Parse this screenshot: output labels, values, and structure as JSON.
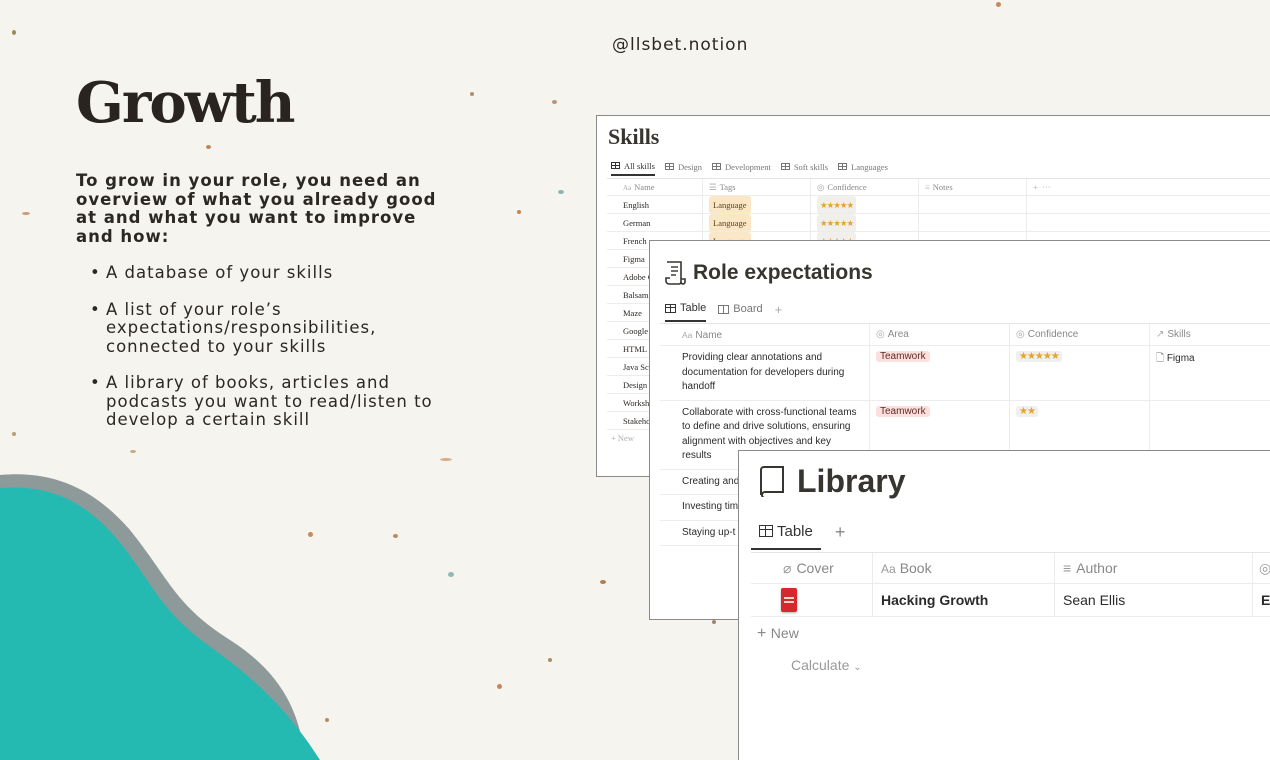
{
  "handle": "@llsbet.notion",
  "title": "Growth",
  "intro": "To grow in your role, you need an overview of what you already good at and what you want to improve and how:",
  "bullets": [
    "A database of your skills",
    "A list of your role’s expectations/responsibilities, connected to your skills",
    "A library of books, articles and podcasts you want to read/listen to develop a certain skill"
  ],
  "colors": {
    "background": "#f6f4ee",
    "teal": "#24bab2",
    "teal_shadow": "#8e9a9a"
  },
  "skills": {
    "title": "Skills",
    "tabs": [
      "All skills",
      "Design",
      "Development",
      "Soft skills",
      "Languages"
    ],
    "columns": {
      "name": "Name",
      "tags": "Tags",
      "confidence": "Confidence",
      "notes": "Notes"
    },
    "rows": [
      {
        "name": "English",
        "tag": "Language",
        "stars": "★★★★★"
      },
      {
        "name": "German",
        "tag": "Language",
        "stars": "★★★★★"
      },
      {
        "name": "French",
        "tag": "Language",
        "stars": "★★★★★"
      },
      {
        "name": "Figma"
      },
      {
        "name": "Adobe C"
      },
      {
        "name": "Balsami"
      },
      {
        "name": "Maze"
      },
      {
        "name": "Google"
      },
      {
        "name": "HTML"
      },
      {
        "name": "Java Scr"
      },
      {
        "name": "Design"
      },
      {
        "name": "Worksh"
      },
      {
        "name": "Stakeho"
      }
    ],
    "new_label": "New"
  },
  "role": {
    "title": "Role expectations",
    "tabs": [
      "Table",
      "Board"
    ],
    "columns": {
      "name": "Name",
      "area": "Area",
      "confidence": "Confidence",
      "skills": "Skills"
    },
    "rows": [
      {
        "name": "Providing clear annotations and documentation for developers during handoff",
        "area": "Teamwork",
        "stars": "★★★★★",
        "skill": "Figma"
      },
      {
        "name": "Collaborate with cross-functional teams to define and drive solutions, ensuring alignment with objectives and key results",
        "area": "Teamwork",
        "stars": "★★"
      },
      {
        "name": "Creating and system that scalability ac"
      },
      {
        "name": "Investing tim attending wo courses"
      },
      {
        "name": "Staying up-t trends and b and advocat"
      }
    ]
  },
  "library": {
    "title": "Library",
    "tab": "Table",
    "columns": {
      "cover": "Cover",
      "book": "Book",
      "author": "Author"
    },
    "rows": [
      {
        "book": "Hacking Growth",
        "author": "Sean Ellis"
      }
    ],
    "new_label": "New",
    "calculate_label": "Calculate"
  }
}
